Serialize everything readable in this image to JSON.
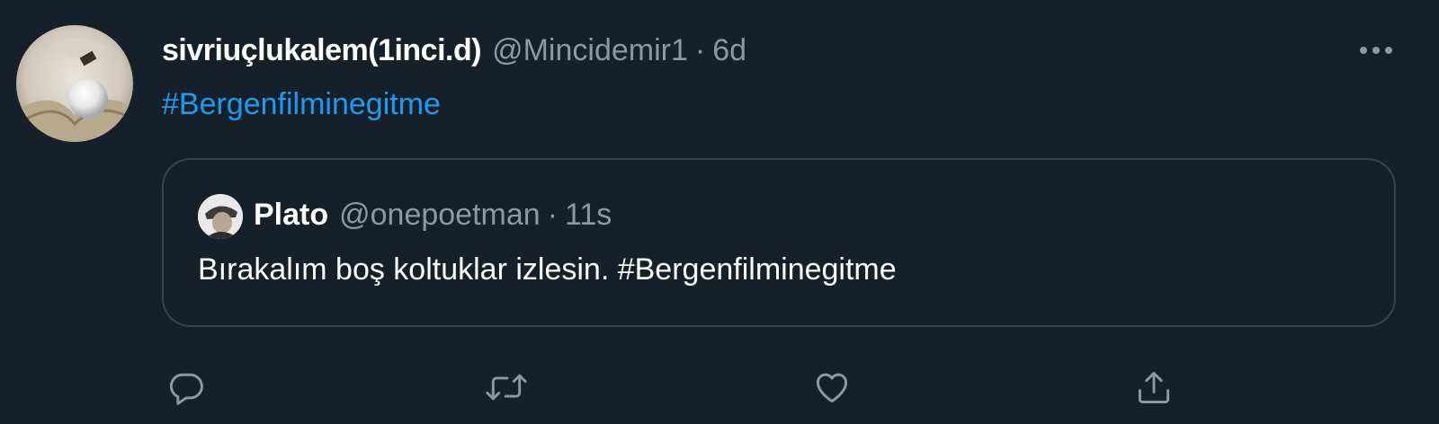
{
  "tweet": {
    "display_name": "sivriuçlukalem(1inci.d)",
    "handle": "@Mincidemir1",
    "separator": "·",
    "time": "6d",
    "text": "#Bergenfilminegitme",
    "more_icon": "more-horizontal-icon",
    "link_color": "#1d9bf0"
  },
  "quoted_tweet": {
    "display_name": "Plato",
    "handle": "@onepoetman",
    "separator": "·",
    "time": "11s",
    "text": "Bırakalım boş koltuklar izlesin. #Bergenfilminegitme"
  },
  "actions": [
    {
      "name": "reply",
      "icon": "reply-icon"
    },
    {
      "name": "retweet",
      "icon": "retweet-icon"
    },
    {
      "name": "like",
      "icon": "like-icon"
    },
    {
      "name": "share",
      "icon": "share-icon"
    }
  ],
  "colors": {
    "background": "#15202b",
    "border": "#38444d",
    "secondary_text": "#8b98a5",
    "primary_text": "#ffffff"
  }
}
